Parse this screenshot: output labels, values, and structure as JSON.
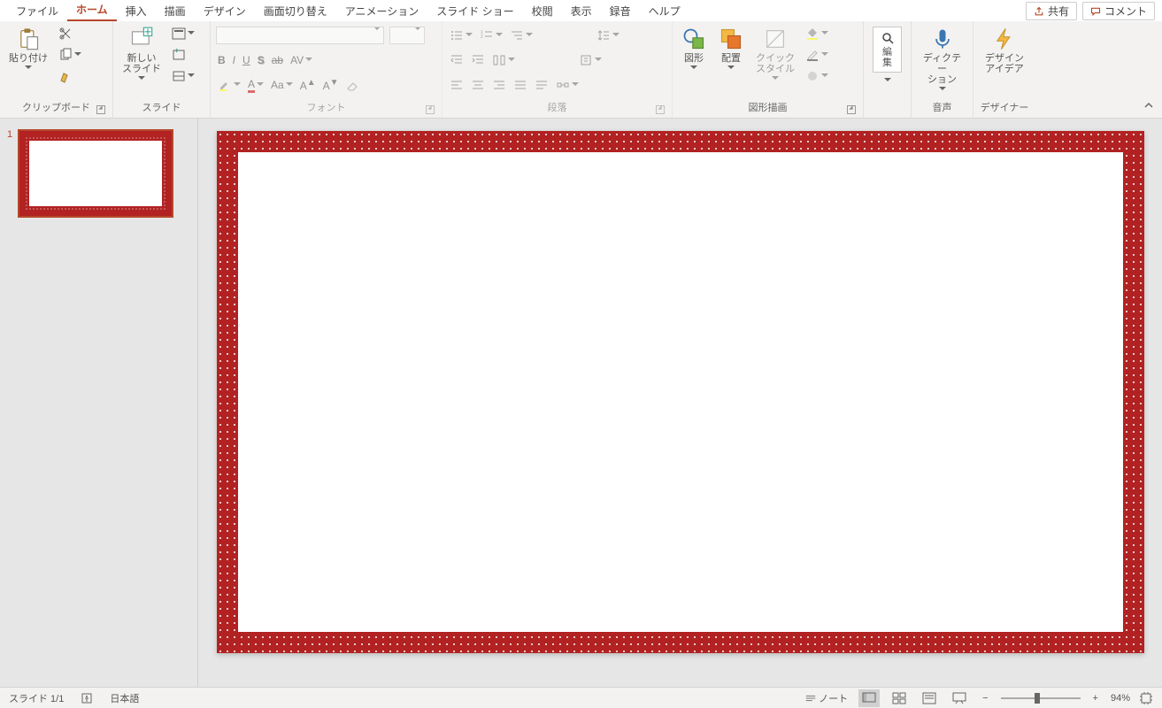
{
  "tabs": {
    "file": "ファイル",
    "home": "ホーム",
    "insert": "挿入",
    "draw": "描画",
    "design": "デザイン",
    "transitions": "画面切り替え",
    "animations": "アニメーション",
    "slideshow": "スライド ショー",
    "review": "校閲",
    "view": "表示",
    "record": "録音",
    "help": "ヘルプ"
  },
  "share_button": "共有",
  "comments_button": "コメント",
  "ribbon": {
    "clipboard": {
      "paste": "貼り付け",
      "label": "クリップボード"
    },
    "slides": {
      "new_slide": "新しい\nスライド",
      "label": "スライド"
    },
    "font": {
      "label": "フォント"
    },
    "paragraph": {
      "label": "段落"
    },
    "drawing": {
      "shapes": "図形",
      "arrange": "配置",
      "quick_styles": "クイック\nスタイル",
      "label": "図形描画"
    },
    "editing": {
      "find": "編集"
    },
    "voice": {
      "dictation": "ディクテー\nション",
      "label": "音声"
    },
    "designer": {
      "design_ideas": "デザイン\nアイデア",
      "label": "デザイナー"
    }
  },
  "thumbnail": {
    "number": "1"
  },
  "status": {
    "slide_count": "スライド 1/1",
    "language": "日本語",
    "notes": "ノート",
    "zoom": "94%"
  }
}
